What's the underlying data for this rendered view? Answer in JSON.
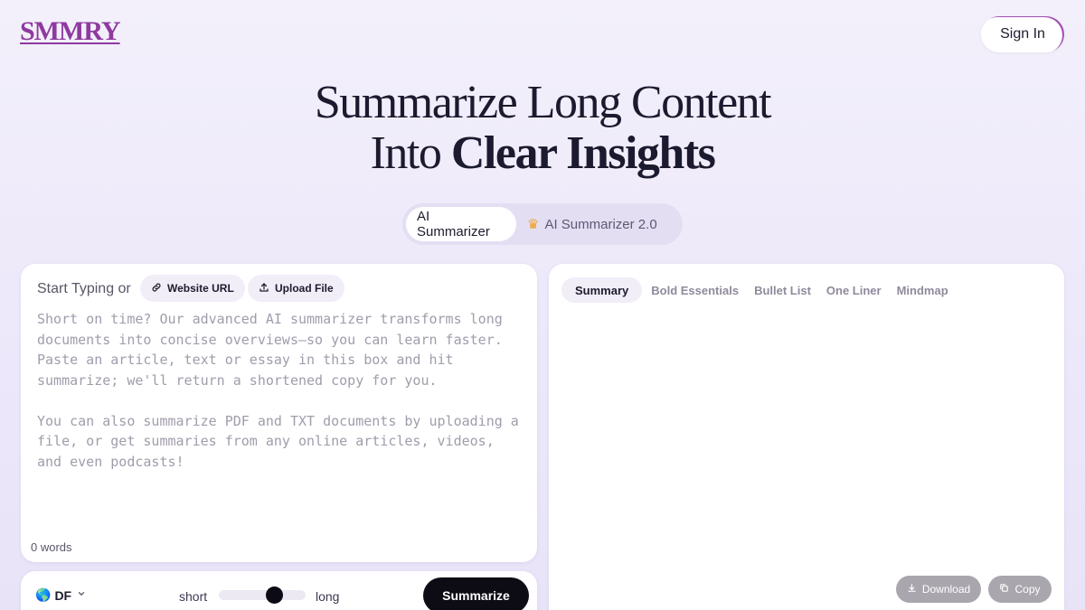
{
  "brand": {
    "logo": "SMMRY"
  },
  "header": {
    "signin_label": "Sign In"
  },
  "hero": {
    "line1": "Summarize Long Content",
    "line2_regular": "Into ",
    "line2_strong": "Clear Insights"
  },
  "mode_tabs": [
    {
      "label": "AI Summarizer",
      "active": true
    },
    {
      "label": "AI Summarizer 2.0",
      "icon": "crown-icon",
      "active": false
    }
  ],
  "input_panel": {
    "start_label": "Start Typing or",
    "url_chip": {
      "label": "Website URL",
      "icon": "link-icon"
    },
    "upload_chip": {
      "label": "Upload File",
      "icon": "upload-icon"
    },
    "placeholder_p1": "Short on time? Our advanced AI summarizer transforms long documents into concise overviews—so you can learn faster. Paste an article, text or essay in this box and hit summarize; we'll return a shortened copy for you.",
    "placeholder_p2": "You can also summarize PDF and TXT documents by uploading a file, or get summaries from any online articles, videos, and even podcasts!",
    "word_count": "0 words"
  },
  "controls": {
    "language": {
      "flag": "🌎",
      "code": "DF"
    },
    "length_short": "short",
    "length_long": "long",
    "length_level": 0.67,
    "summarize_label": "Summarize"
  },
  "output_panel": {
    "tabs": [
      {
        "label": "Summary",
        "active": true
      },
      {
        "label": "Bold Essentials",
        "active": false
      },
      {
        "label": "Bullet List",
        "active": false
      },
      {
        "label": "One Liner",
        "active": false
      },
      {
        "label": "Mindmap",
        "active": false
      }
    ],
    "download_label": "Download",
    "copy_label": "Copy"
  },
  "colors": {
    "brand": "#8e3a9e",
    "primary_button": "#0d0b14",
    "disabled_button": "#a9a6ae",
    "crown": "#f0a020"
  }
}
